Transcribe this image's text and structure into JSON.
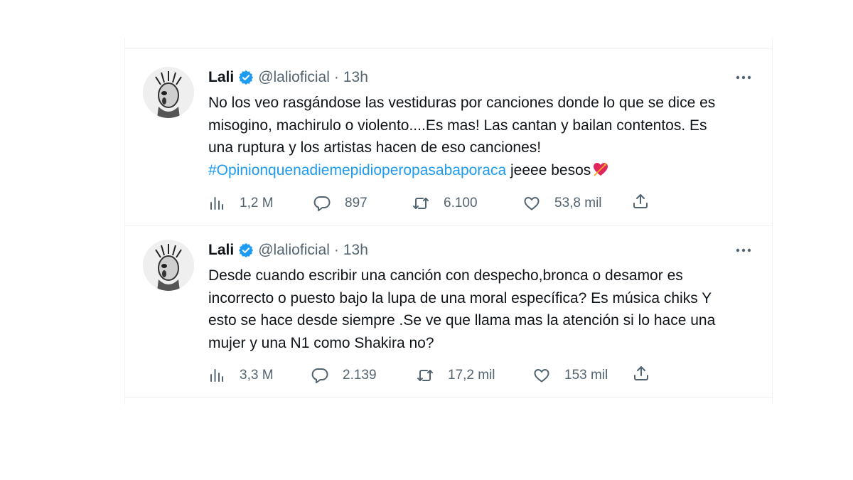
{
  "tweets": [
    {
      "author_name": "Lali",
      "handle": "@lalioficial",
      "separator": "·",
      "time": "13h",
      "text": "No los veo rasgándose las vestiduras por canciones donde lo que se dice es\nmisogino, machirulo o violento....Es mas! Las cantan y bailan contentos. Es\nuna ruptura y los artistas hacen de eso canciones!\n",
      "hashtag": "#Opinionquenadiemepidioperopasabaporaca",
      "text_after_hashtag": " jeeee besos",
      "views": "1,2 M",
      "replies": "897",
      "retweets": "6.100",
      "likes": "53,8 mil"
    },
    {
      "author_name": "Lali",
      "handle": "@lalioficial",
      "separator": "·",
      "time": "13h",
      "text": "Desde cuando escribir una canción con despecho,bronca o desamor es\nincorrecto o puesto bajo la lupa de una moral específica? Es música chiks Y\nesto se hace desde siempre .Se ve que llama mas la atención si lo hace una\nmujer y una N1 como Shakira no?",
      "views": "3,3 M",
      "replies": "2.139",
      "retweets": "17,2 mil",
      "likes": "153 mil"
    }
  ],
  "icons": {
    "verified": "verified-badge-icon",
    "more": "more-dots-icon",
    "views": "views-bar-icon",
    "reply": "reply-bubble-icon",
    "retweet": "retweet-icon",
    "like": "heart-icon",
    "share": "share-icon",
    "emoji": "heart-with-arrow-emoji"
  },
  "colors": {
    "accent": "#1d9bf0",
    "text": "#0f1419",
    "secondary": "#536471",
    "divider": "#eff3f4"
  }
}
